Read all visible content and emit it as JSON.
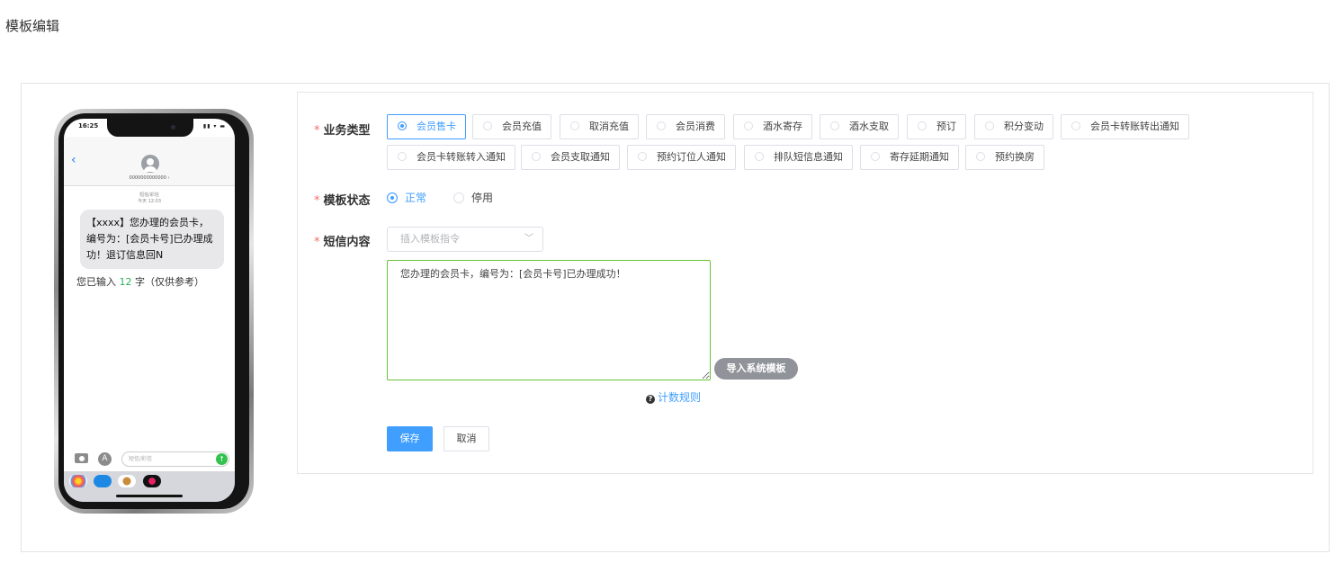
{
  "page": {
    "title": "模板编辑"
  },
  "phone": {
    "status_time": "16:25",
    "status_icons": "▮▮ ▾ ▬",
    "back_glyph": "‹",
    "contact_number": "0000000000000 ›",
    "msg_time_line1": "短信/彩信",
    "msg_time_line2": "今天 12:03",
    "message": "【xxxx】您办理的会员卡，编号为：[会员卡号]已办理成功！退订信息回N",
    "count_prefix": "您已输入",
    "count_value": "12",
    "count_suffix": "字（仅供参考）",
    "input_placeholder": "短信/彩信",
    "appstore_glyph": "A",
    "send_glyph": "↑"
  },
  "form": {
    "business_type": {
      "label": "业务类型",
      "options": [
        "会员售卡",
        "会员充值",
        "取消充值",
        "会员消费",
        "酒水寄存",
        "酒水支取",
        "预订",
        "积分变动",
        "会员卡转账转出通知",
        "会员卡转账转入通知",
        "会员支取通知",
        "预约订位人通知",
        "排队短信息通知",
        "寄存延期通知",
        "预约换房"
      ],
      "selected": "会员售卡"
    },
    "template_status": {
      "label": "模板状态",
      "options": [
        "正常",
        "停用"
      ],
      "selected": "正常"
    },
    "sms_content": {
      "label": "短信内容",
      "insert_placeholder": "插入模板指令",
      "chevron_glyph": "﹀",
      "value": "您办理的会员卡，编号为：[会员卡号]已办理成功！",
      "import_button": "导入系统模板",
      "rules_icon": "?",
      "rules_link": "计数规则"
    },
    "required_mark": "*",
    "save_button": "保存",
    "cancel_button": "取消"
  },
  "colors": {
    "primary": "#409eff",
    "success": "#67c23a",
    "required": "#f56c6c",
    "gray_button": "#909399"
  }
}
